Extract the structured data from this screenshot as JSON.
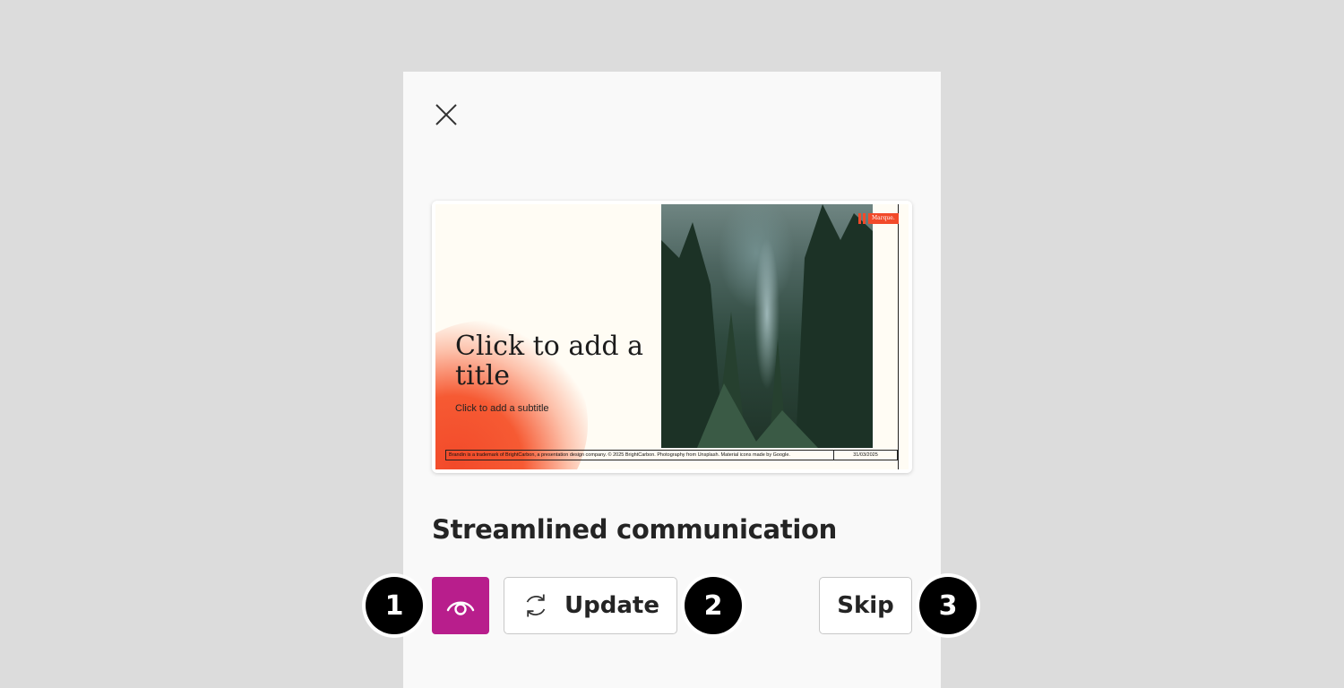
{
  "dialog": {
    "close_icon": "close-icon",
    "slide": {
      "title": "Click to add a title",
      "subtitle": "Click to add a subtitle",
      "logo_text": "Marque.",
      "footer_text": "Brandin is a trademark of BrightCarbon, a presentation design company. © 2025 BrightCarbon. Photography from Unsplash. Material icons made by Google.",
      "footer_date": "31/03/2025"
    },
    "design_name": "Streamlined communication",
    "buttons": {
      "preview_icon": "eye-icon",
      "update_label": "Update",
      "update_icon": "refresh-icon",
      "skip_label": "Skip"
    }
  },
  "badges": [
    "1",
    "2",
    "3"
  ],
  "colors": {
    "background": "#dcdcdc",
    "panel": "#f9f9f9",
    "accent": "#b81e8c",
    "slide_orange": "#f24a2a"
  }
}
